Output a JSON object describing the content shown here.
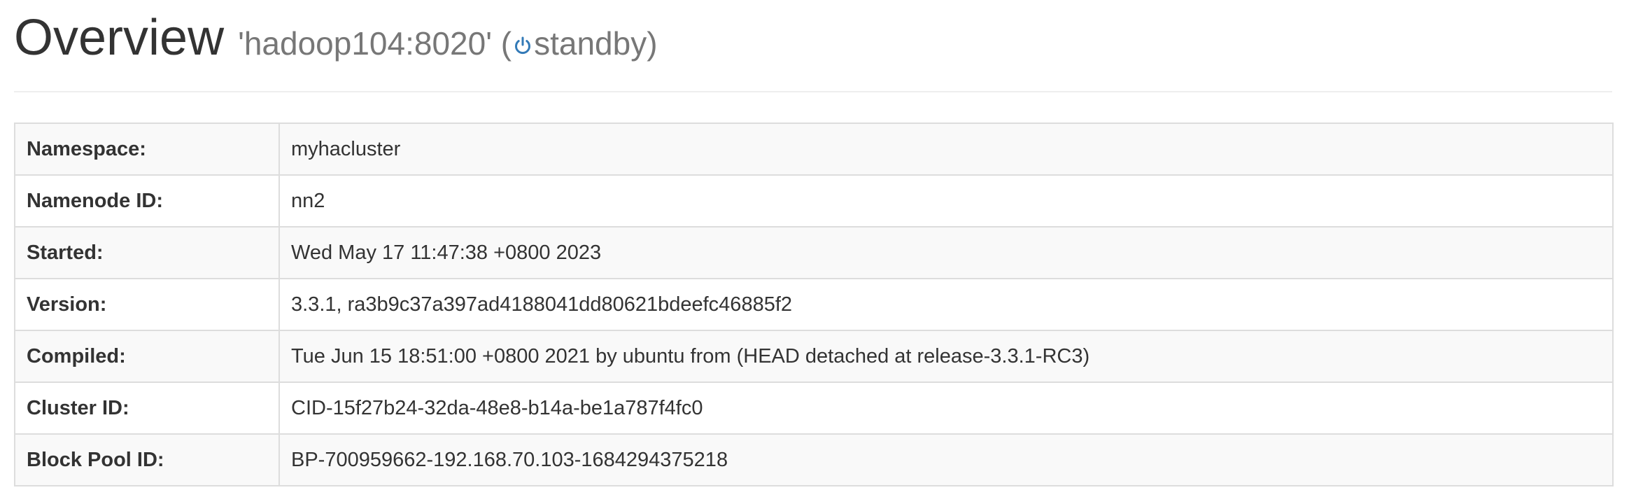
{
  "header": {
    "title": "Overview",
    "host": "'hadoop104:8020'",
    "state_open": " (",
    "state_icon": "power-icon",
    "state": "standby",
    "state_close": ")"
  },
  "colors": {
    "icon_blue": "#337ab7",
    "subtitle_gray": "#777777",
    "stripe": "#f9f9f9",
    "border": "#dddddd"
  },
  "overview_table": {
    "rows": [
      {
        "label": "Namespace:",
        "value": "myhacluster"
      },
      {
        "label": "Namenode ID:",
        "value": "nn2"
      },
      {
        "label": "Started:",
        "value": "Wed May 17 11:47:38 +0800 2023"
      },
      {
        "label": "Version:",
        "value": "3.3.1, ra3b9c37a397ad4188041dd80621bdeefc46885f2"
      },
      {
        "label": "Compiled:",
        "value": "Tue Jun 15 18:51:00 +0800 2021 by ubuntu from (HEAD detached at release-3.3.1-RC3)"
      },
      {
        "label": "Cluster ID:",
        "value": "CID-15f27b24-32da-48e8-b14a-be1a787f4fc0"
      },
      {
        "label": "Block Pool ID:",
        "value": "BP-700959662-192.168.70.103-1684294375218"
      }
    ]
  }
}
